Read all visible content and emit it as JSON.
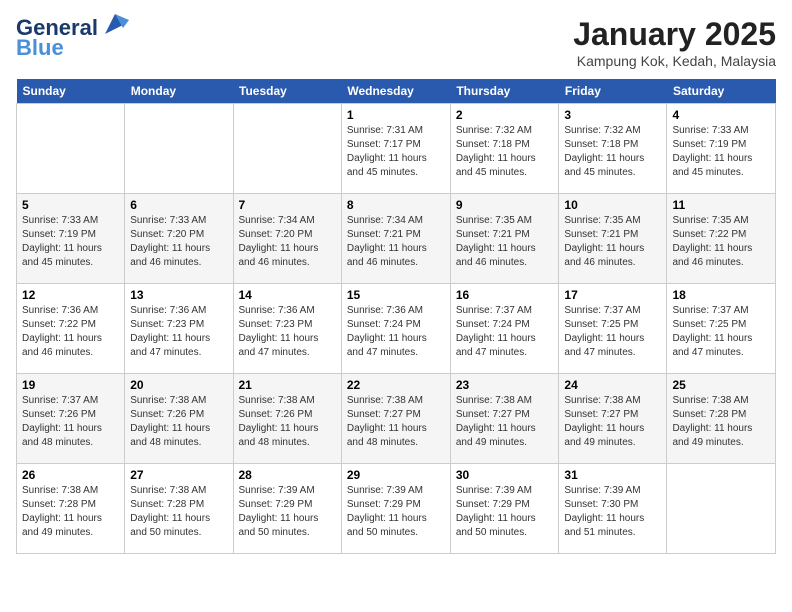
{
  "logo": {
    "line1": "General",
    "line2": "Blue"
  },
  "title": "January 2025",
  "subtitle": "Kampung Kok, Kedah, Malaysia",
  "weekdays": [
    "Sunday",
    "Monday",
    "Tuesday",
    "Wednesday",
    "Thursday",
    "Friday",
    "Saturday"
  ],
  "weeks": [
    [
      {
        "day": "",
        "info": ""
      },
      {
        "day": "",
        "info": ""
      },
      {
        "day": "",
        "info": ""
      },
      {
        "day": "1",
        "info": "Sunrise: 7:31 AM\nSunset: 7:17 PM\nDaylight: 11 hours and 45 minutes."
      },
      {
        "day": "2",
        "info": "Sunrise: 7:32 AM\nSunset: 7:18 PM\nDaylight: 11 hours and 45 minutes."
      },
      {
        "day": "3",
        "info": "Sunrise: 7:32 AM\nSunset: 7:18 PM\nDaylight: 11 hours and 45 minutes."
      },
      {
        "day": "4",
        "info": "Sunrise: 7:33 AM\nSunset: 7:19 PM\nDaylight: 11 hours and 45 minutes."
      }
    ],
    [
      {
        "day": "5",
        "info": "Sunrise: 7:33 AM\nSunset: 7:19 PM\nDaylight: 11 hours and 45 minutes."
      },
      {
        "day": "6",
        "info": "Sunrise: 7:33 AM\nSunset: 7:20 PM\nDaylight: 11 hours and 46 minutes."
      },
      {
        "day": "7",
        "info": "Sunrise: 7:34 AM\nSunset: 7:20 PM\nDaylight: 11 hours and 46 minutes."
      },
      {
        "day": "8",
        "info": "Sunrise: 7:34 AM\nSunset: 7:21 PM\nDaylight: 11 hours and 46 minutes."
      },
      {
        "day": "9",
        "info": "Sunrise: 7:35 AM\nSunset: 7:21 PM\nDaylight: 11 hours and 46 minutes."
      },
      {
        "day": "10",
        "info": "Sunrise: 7:35 AM\nSunset: 7:21 PM\nDaylight: 11 hours and 46 minutes."
      },
      {
        "day": "11",
        "info": "Sunrise: 7:35 AM\nSunset: 7:22 PM\nDaylight: 11 hours and 46 minutes."
      }
    ],
    [
      {
        "day": "12",
        "info": "Sunrise: 7:36 AM\nSunset: 7:22 PM\nDaylight: 11 hours and 46 minutes."
      },
      {
        "day": "13",
        "info": "Sunrise: 7:36 AM\nSunset: 7:23 PM\nDaylight: 11 hours and 47 minutes."
      },
      {
        "day": "14",
        "info": "Sunrise: 7:36 AM\nSunset: 7:23 PM\nDaylight: 11 hours and 47 minutes."
      },
      {
        "day": "15",
        "info": "Sunrise: 7:36 AM\nSunset: 7:24 PM\nDaylight: 11 hours and 47 minutes."
      },
      {
        "day": "16",
        "info": "Sunrise: 7:37 AM\nSunset: 7:24 PM\nDaylight: 11 hours and 47 minutes."
      },
      {
        "day": "17",
        "info": "Sunrise: 7:37 AM\nSunset: 7:25 PM\nDaylight: 11 hours and 47 minutes."
      },
      {
        "day": "18",
        "info": "Sunrise: 7:37 AM\nSunset: 7:25 PM\nDaylight: 11 hours and 47 minutes."
      }
    ],
    [
      {
        "day": "19",
        "info": "Sunrise: 7:37 AM\nSunset: 7:26 PM\nDaylight: 11 hours and 48 minutes."
      },
      {
        "day": "20",
        "info": "Sunrise: 7:38 AM\nSunset: 7:26 PM\nDaylight: 11 hours and 48 minutes."
      },
      {
        "day": "21",
        "info": "Sunrise: 7:38 AM\nSunset: 7:26 PM\nDaylight: 11 hours and 48 minutes."
      },
      {
        "day": "22",
        "info": "Sunrise: 7:38 AM\nSunset: 7:27 PM\nDaylight: 11 hours and 48 minutes."
      },
      {
        "day": "23",
        "info": "Sunrise: 7:38 AM\nSunset: 7:27 PM\nDaylight: 11 hours and 49 minutes."
      },
      {
        "day": "24",
        "info": "Sunrise: 7:38 AM\nSunset: 7:27 PM\nDaylight: 11 hours and 49 minutes."
      },
      {
        "day": "25",
        "info": "Sunrise: 7:38 AM\nSunset: 7:28 PM\nDaylight: 11 hours and 49 minutes."
      }
    ],
    [
      {
        "day": "26",
        "info": "Sunrise: 7:38 AM\nSunset: 7:28 PM\nDaylight: 11 hours and 49 minutes."
      },
      {
        "day": "27",
        "info": "Sunrise: 7:38 AM\nSunset: 7:28 PM\nDaylight: 11 hours and 50 minutes."
      },
      {
        "day": "28",
        "info": "Sunrise: 7:39 AM\nSunset: 7:29 PM\nDaylight: 11 hours and 50 minutes."
      },
      {
        "day": "29",
        "info": "Sunrise: 7:39 AM\nSunset: 7:29 PM\nDaylight: 11 hours and 50 minutes."
      },
      {
        "day": "30",
        "info": "Sunrise: 7:39 AM\nSunset: 7:29 PM\nDaylight: 11 hours and 50 minutes."
      },
      {
        "day": "31",
        "info": "Sunrise: 7:39 AM\nSunset: 7:30 PM\nDaylight: 11 hours and 51 minutes."
      },
      {
        "day": "",
        "info": ""
      }
    ]
  ]
}
